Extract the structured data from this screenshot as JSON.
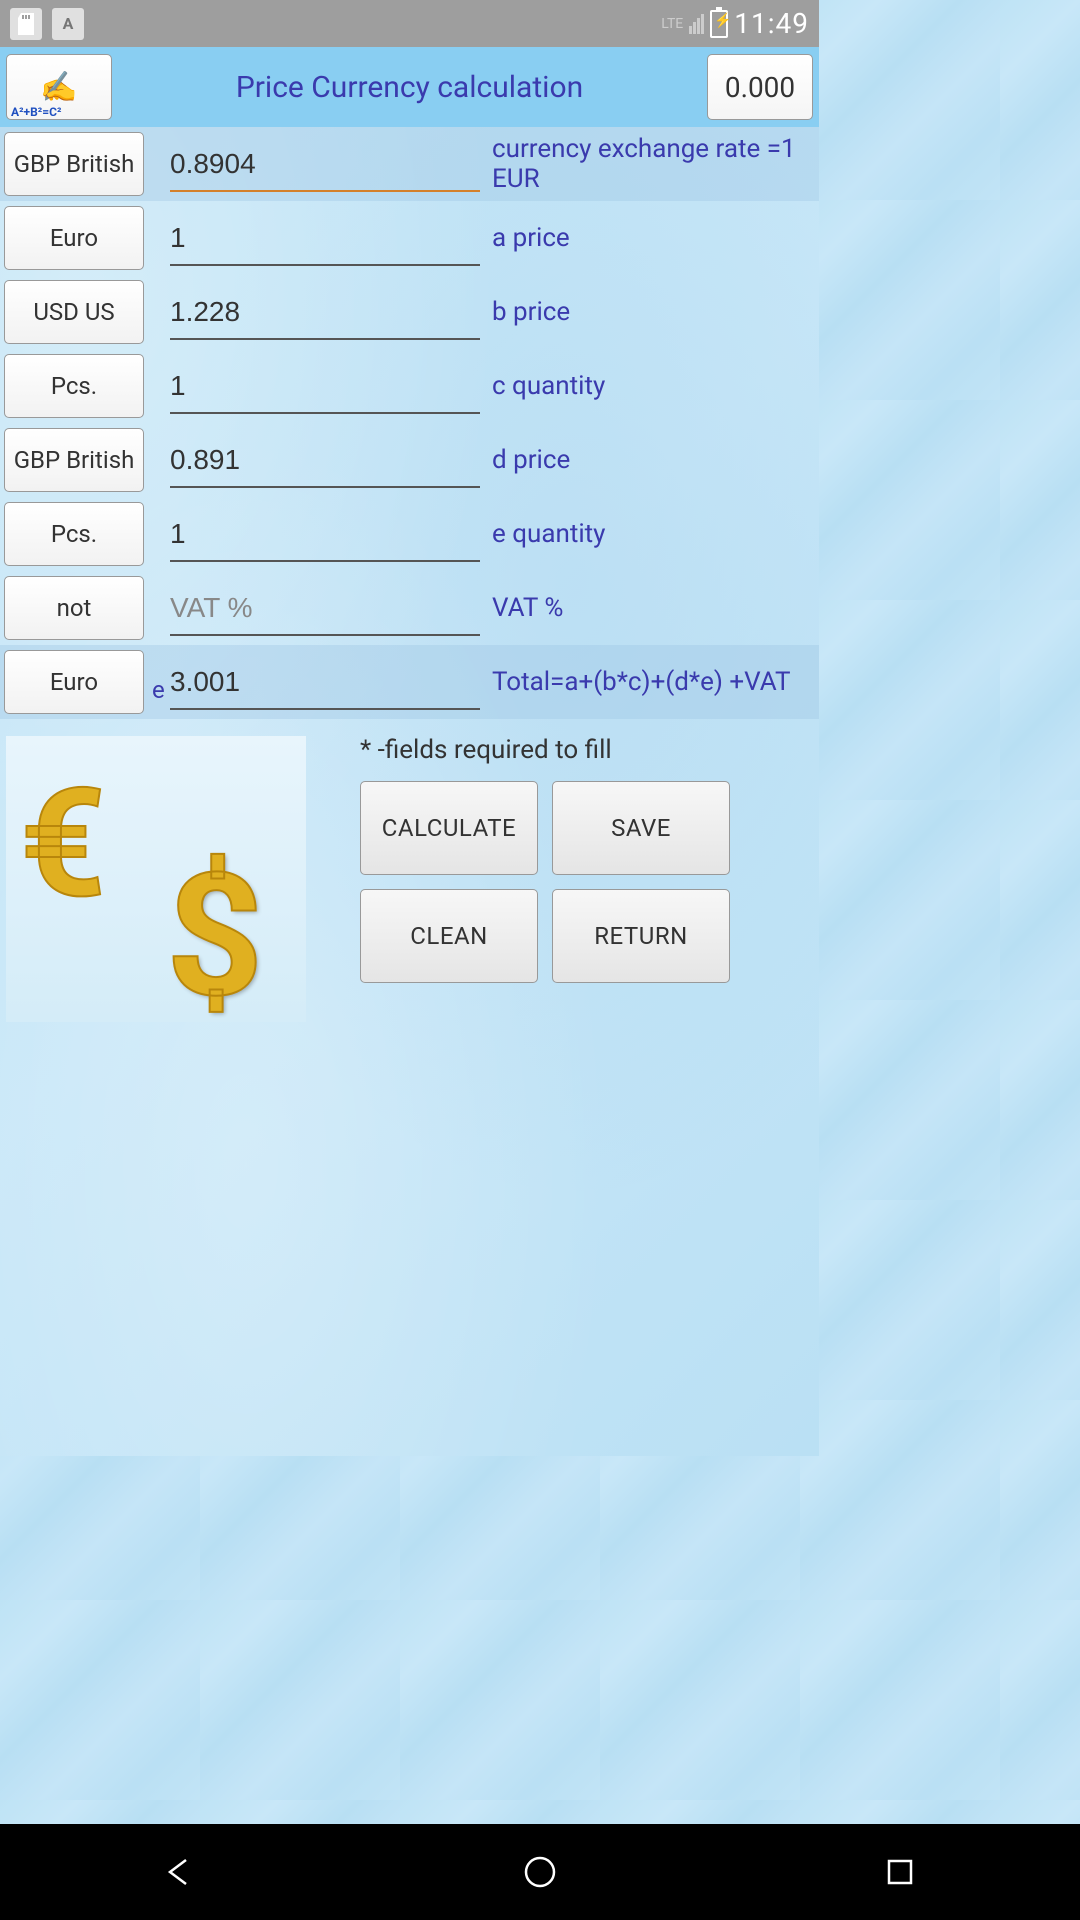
{
  "statusbar": {
    "lte": "LTE",
    "time": "11:49"
  },
  "titlebar": {
    "formula": "A²+B²=C²",
    "title": "Price Currency calculation",
    "zero_label": "0.000"
  },
  "rows": [
    {
      "btn": "GBP British",
      "value": "0.8904",
      "placeholder": "",
      "label": "currency exchange rate =1 EUR"
    },
    {
      "btn": "Euro",
      "value": "1",
      "placeholder": "",
      "label": "a price"
    },
    {
      "btn": "USD US",
      "value": "1.228",
      "placeholder": "",
      "label": "b price"
    },
    {
      "btn": "Pcs.",
      "value": "1",
      "placeholder": "",
      "label": "c quantity"
    },
    {
      "btn": "GBP British",
      "value": "0.891",
      "placeholder": "",
      "label": "d price"
    },
    {
      "btn": "Pcs.",
      "value": "1",
      "placeholder": "",
      "label": "e quantity"
    },
    {
      "btn": "not",
      "value": "",
      "placeholder": "VAT %",
      "label": "VAT %"
    },
    {
      "btn": "Euro",
      "value": "3.001",
      "placeholder": "",
      "label": "Total=a+(b*c)+(d*e) +VAT",
      "hint_e": "e"
    }
  ],
  "note": "* -fields required to fill",
  "actions": {
    "calculate": "CALCULATE",
    "save": "SAVE",
    "clean": "CLEAN",
    "return": "RETURN"
  }
}
